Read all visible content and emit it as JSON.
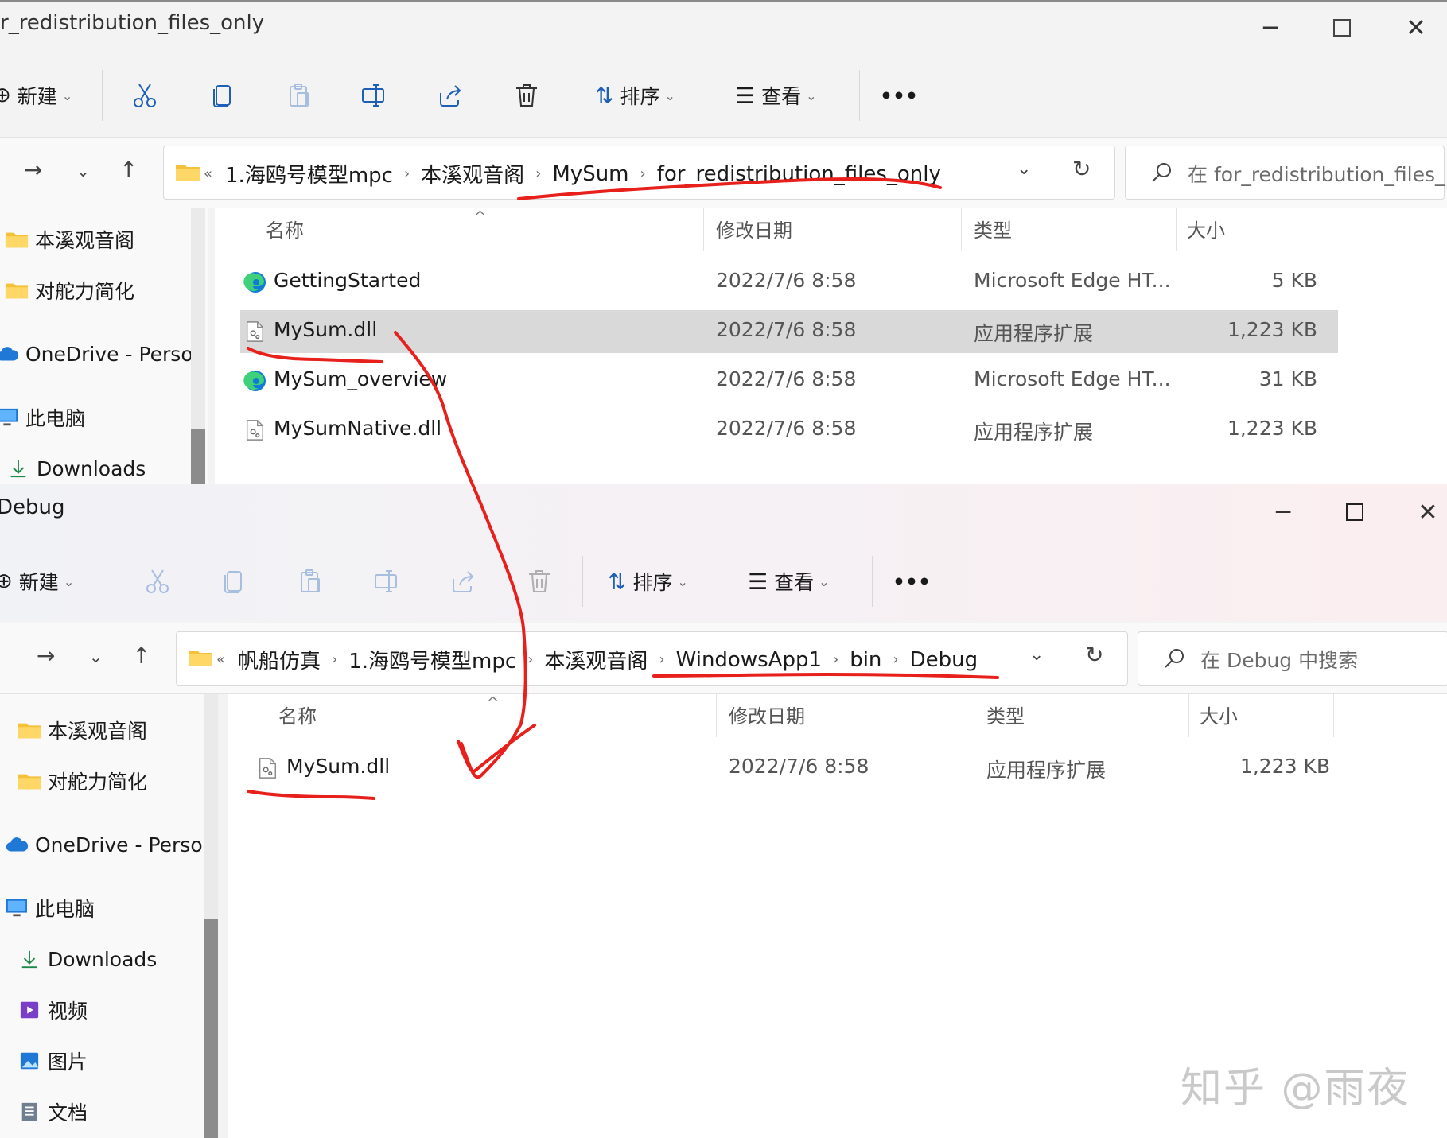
{
  "window_top": {
    "title": "r_redistribution_files_only",
    "toolbar": {
      "new_label": "新建",
      "sort_label": "排序",
      "view_label": "查看",
      "more_label": "•••"
    },
    "address": {
      "overflow": "«",
      "crumbs": [
        "1.海鸥号模型mpc",
        "本溪观音阁",
        "MySum",
        "for_redistribution_files_only"
      ]
    },
    "search_placeholder": "在 for_redistribution_files_...",
    "sidebar": [
      {
        "label": "本溪观音阁",
        "icon": "folder-icon"
      },
      {
        "label": "对舵力简化",
        "icon": "folder-icon"
      },
      {
        "label": "OneDrive - Persor",
        "icon": "onedrive-cloud-icon"
      },
      {
        "label": "此电脑",
        "icon": "computer-icon"
      },
      {
        "label": "Downloads",
        "icon": "download-arrow-icon"
      }
    ],
    "columns": {
      "name": "名称",
      "modified": "修改日期",
      "type": "类型",
      "size": "大小"
    },
    "files": [
      {
        "name": "GettingStarted",
        "modified": "2022/7/6 8:58",
        "type": "Microsoft Edge HT...",
        "size": "5 KB",
        "icon": "edge-icon",
        "selected": false
      },
      {
        "name": "MySum.dll",
        "modified": "2022/7/6 8:58",
        "type": "应用程序扩展",
        "size": "1,223 KB",
        "icon": "dll-file-icon",
        "selected": true
      },
      {
        "name": "MySum_overview",
        "modified": "2022/7/6 8:58",
        "type": "Microsoft Edge HT...",
        "size": "31 KB",
        "icon": "edge-icon",
        "selected": false
      },
      {
        "name": "MySumNative.dll",
        "modified": "2022/7/6 8:58",
        "type": "应用程序扩展",
        "size": "1,223 KB",
        "icon": "dll-file-icon",
        "selected": false
      }
    ]
  },
  "window_bottom": {
    "title": "Debug",
    "toolbar": {
      "new_label": "新建",
      "sort_label": "排序",
      "view_label": "查看",
      "more_label": "•••"
    },
    "address": {
      "overflow": "«",
      "crumbs": [
        "帆船仿真",
        "1.海鸥号模型mpc",
        "本溪观音阁",
        "WindowsApp1",
        "bin",
        "Debug"
      ]
    },
    "search_placeholder": "在 Debug 中搜索",
    "sidebar": [
      {
        "label": "本溪观音阁",
        "icon": "folder-icon"
      },
      {
        "label": "对舵力简化",
        "icon": "folder-icon"
      },
      {
        "label": "OneDrive - Persor",
        "icon": "onedrive-cloud-icon"
      },
      {
        "label": "此电脑",
        "icon": "computer-icon"
      },
      {
        "label": "Downloads",
        "icon": "download-arrow-icon"
      },
      {
        "label": "视频",
        "icon": "video-icon"
      },
      {
        "label": "图片",
        "icon": "pictures-icon"
      },
      {
        "label": "文档",
        "icon": "documents-icon"
      }
    ],
    "columns": {
      "name": "名称",
      "modified": "修改日期",
      "type": "类型",
      "size": "大小"
    },
    "files": [
      {
        "name": "MySum.dll",
        "modified": "2022/7/6 8:58",
        "type": "应用程序扩展",
        "size": "1,223 KB",
        "icon": "dll-file-icon",
        "selected": false
      }
    ]
  },
  "watermark": "知乎 @雨夜",
  "colors": {
    "annotation_red": "#e8201c",
    "selection_gray": "#d9d9d9",
    "folder_yellow": "#f5c13b",
    "onedrive_blue": "#1f77d6"
  }
}
